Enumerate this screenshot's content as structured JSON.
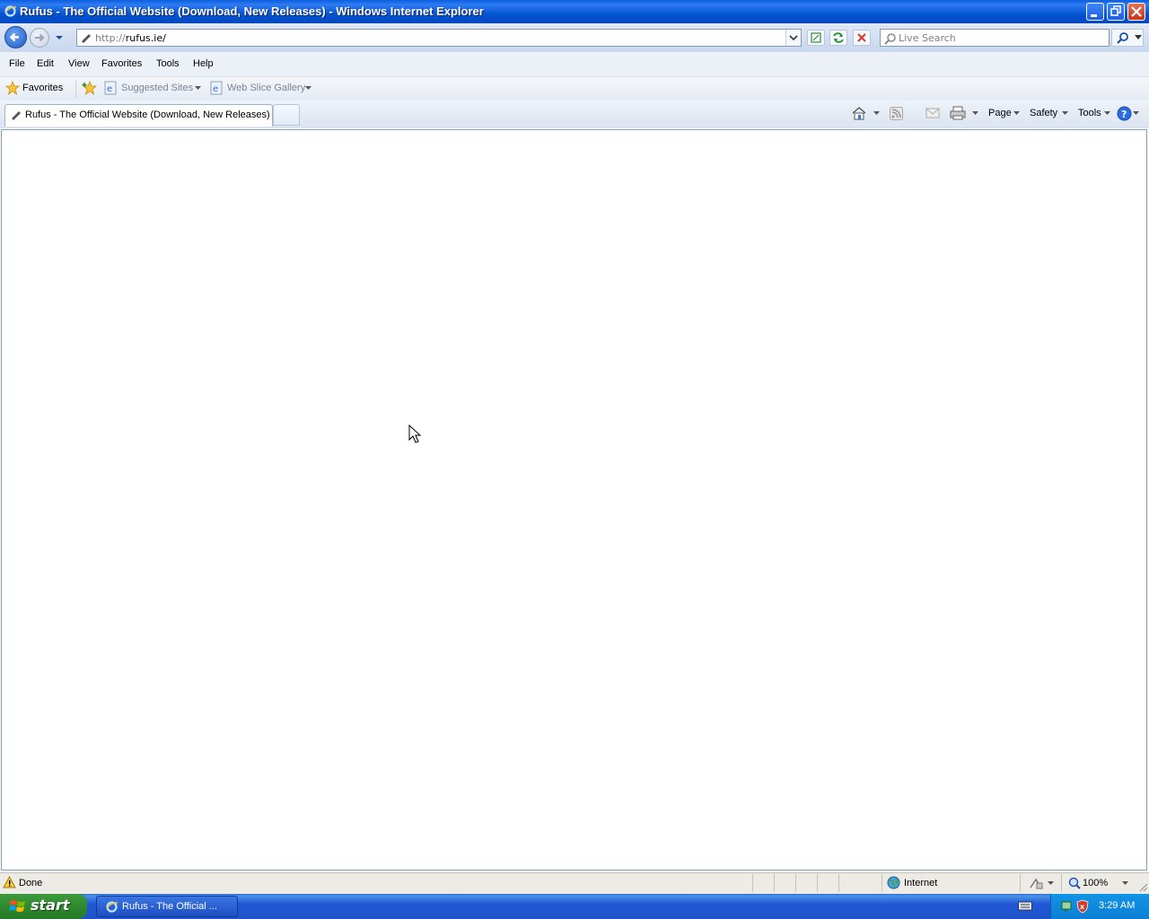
{
  "window": {
    "title": "Rufus - The Official Website (Download, New Releases) - Windows Internet Explorer",
    "buttons": [
      "minimize",
      "restore",
      "close"
    ]
  },
  "address_bar": {
    "url_protocol": "http://",
    "url_host": "rufus.ie/",
    "search_placeholder": "Live Search"
  },
  "menu": {
    "items": [
      "File",
      "Edit",
      "View",
      "Favorites",
      "Tools",
      "Help"
    ]
  },
  "favorites_bar": {
    "favorites_label": "Favorites",
    "suggested_sites": "Suggested Sites",
    "web_slice_gallery": "Web Slice Gallery"
  },
  "tabs": {
    "active_tab": "Rufus - The Official Website (Download, New Releases)"
  },
  "command_bar": {
    "page": "Page",
    "safety": "Safety",
    "tools": "Tools"
  },
  "status_bar": {
    "status": "Done",
    "zone": "Internet",
    "zoom": "100%"
  },
  "taskbar": {
    "start": "start",
    "task_item": "Rufus - The Official ...",
    "clock": "3:29 AM"
  },
  "colors": {
    "titlebar": "#0454d4",
    "start_button": "#2f8a2f",
    "taskbar": "#2157d7"
  }
}
